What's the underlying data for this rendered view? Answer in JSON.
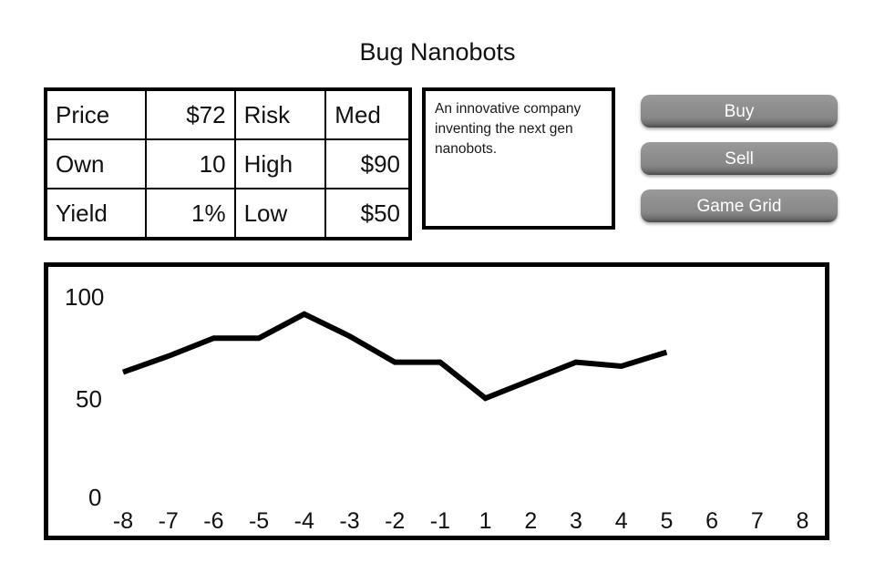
{
  "header": {
    "title": "Bug Nanobots"
  },
  "stats_table": {
    "rows": [
      {
        "cells": [
          "Price",
          "$72",
          "Risk",
          "Med"
        ]
      },
      {
        "cells": [
          "Own",
          "10",
          "High",
          "$90"
        ]
      },
      {
        "cells": [
          "Yield",
          "1%",
          "Low",
          "$50"
        ]
      }
    ]
  },
  "description": {
    "text": "An innovative company inventing the next gen nanobots."
  },
  "buttons": [
    {
      "label": "Buy",
      "name": "buy-button"
    },
    {
      "label": "Sell",
      "name": "sell-button"
    },
    {
      "label": "Game Grid",
      "name": "game-grid-button"
    }
  ],
  "colors": {
    "button_face": "#8d8d8d",
    "button_text": "#ffffff",
    "line": "#000000",
    "border": "#000000",
    "background": "#ffffff"
  },
  "chart_data": {
    "type": "line",
    "title": "",
    "xlabel": "",
    "ylabel": "",
    "x": [
      -8,
      -7,
      -6,
      -5,
      -4,
      -3,
      -2,
      -1,
      1,
      2,
      3,
      4,
      5
    ],
    "values": [
      62,
      70,
      79,
      79,
      91,
      80,
      67,
      67,
      49,
      58,
      67,
      65,
      72
    ],
    "xticks": [
      -8,
      -7,
      -6,
      -5,
      -4,
      -3,
      -2,
      -1,
      1,
      2,
      3,
      4,
      5,
      6,
      7,
      8
    ],
    "xtick_labels": [
      "-8",
      "-7",
      "-6",
      "-5",
      "-4",
      "-3",
      "-2",
      "-1",
      "1",
      "2",
      "3",
      "4",
      "5",
      "6",
      "7",
      "8"
    ],
    "yticks": [
      0,
      50,
      100
    ],
    "ytick_labels": [
      "0",
      "50",
      "100"
    ],
    "ylim": [
      0,
      100
    ],
    "xlim": [
      -8,
      8
    ],
    "grid": false,
    "legend": false,
    "series_name": "price"
  }
}
